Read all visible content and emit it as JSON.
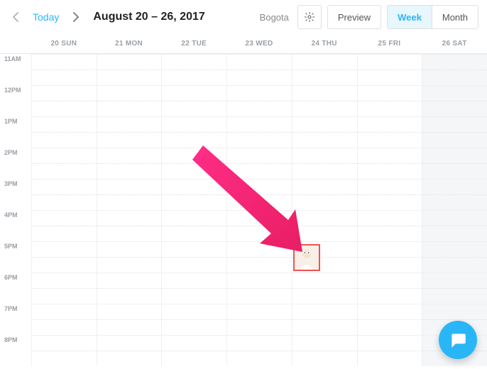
{
  "toolbar": {
    "today_label": "Today",
    "date_range": "August 20 – 26, 2017",
    "timezone": "Bogota",
    "preview_label": "Preview",
    "week_label": "Week",
    "month_label": "Month"
  },
  "days": [
    {
      "num": "20",
      "abbr": "SUN"
    },
    {
      "num": "21",
      "abbr": "MON"
    },
    {
      "num": "22",
      "abbr": "TUE"
    },
    {
      "num": "23",
      "abbr": "WED"
    },
    {
      "num": "24",
      "abbr": "THU"
    },
    {
      "num": "25",
      "abbr": "FRI"
    },
    {
      "num": "26",
      "abbr": "SAT"
    }
  ],
  "hours": [
    "11AM",
    "12PM",
    "1PM",
    "2PM",
    "3PM",
    "4PM",
    "5PM",
    "6PM",
    "7PM",
    "8PM"
  ],
  "event": {
    "day_index": 4,
    "hour_index": 6
  }
}
